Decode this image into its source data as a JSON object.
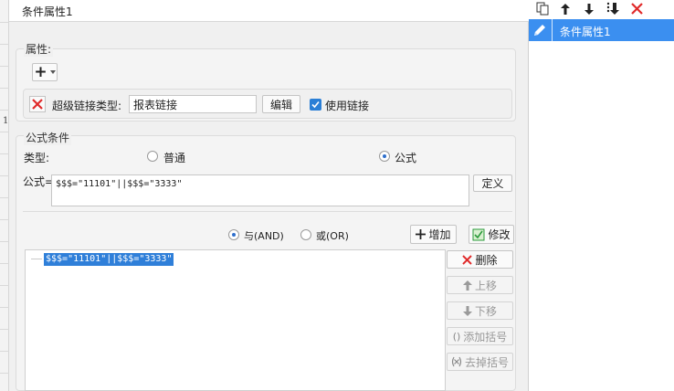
{
  "left_strip": {
    "row_marker": "1"
  },
  "dialog": {
    "title": "条件属性1",
    "properties_group": {
      "title": "属性:",
      "add_button_symbol": "+",
      "hyperlink_type_label": "超级链接类型:",
      "hyperlink_type_value": "报表链接",
      "edit_button": "编辑",
      "use_link_checked": true,
      "use_link_label": "使用链接"
    },
    "formula_group": {
      "title": "公式条件",
      "type_label": "类型:",
      "type_options": [
        {
          "label": "普通",
          "selected": false
        },
        {
          "label": "公式",
          "selected": true
        }
      ],
      "formula_label": "公式=",
      "formula_value": "$$$=\"11101\"||$$$=\"3333\"",
      "define_button": "定义"
    },
    "logic": {
      "and_label": "与(AND)",
      "and_selected": true,
      "or_label": "或(OR)",
      "or_selected": false,
      "add_button": "增加",
      "modify_button": "修改"
    },
    "condition_list": [
      "$$$=\"11101\"||$$$=\"3333\""
    ],
    "list_actions": {
      "delete": "删除",
      "move_up": "上移",
      "move_down": "下移",
      "add_bracket": "添加括号",
      "remove_bracket": "去掉括号"
    }
  },
  "right_panel": {
    "toolbar": [
      "copy-icon",
      "arrow-up-icon",
      "arrow-down-icon",
      "sort-icon",
      "delete-icon"
    ],
    "items": [
      {
        "label": "条件属性1",
        "selected": true
      }
    ]
  },
  "colors": {
    "selection_blue": "#3b8ff0",
    "delete_red": "#e02a2a",
    "add_green": "#2b9a3a"
  }
}
